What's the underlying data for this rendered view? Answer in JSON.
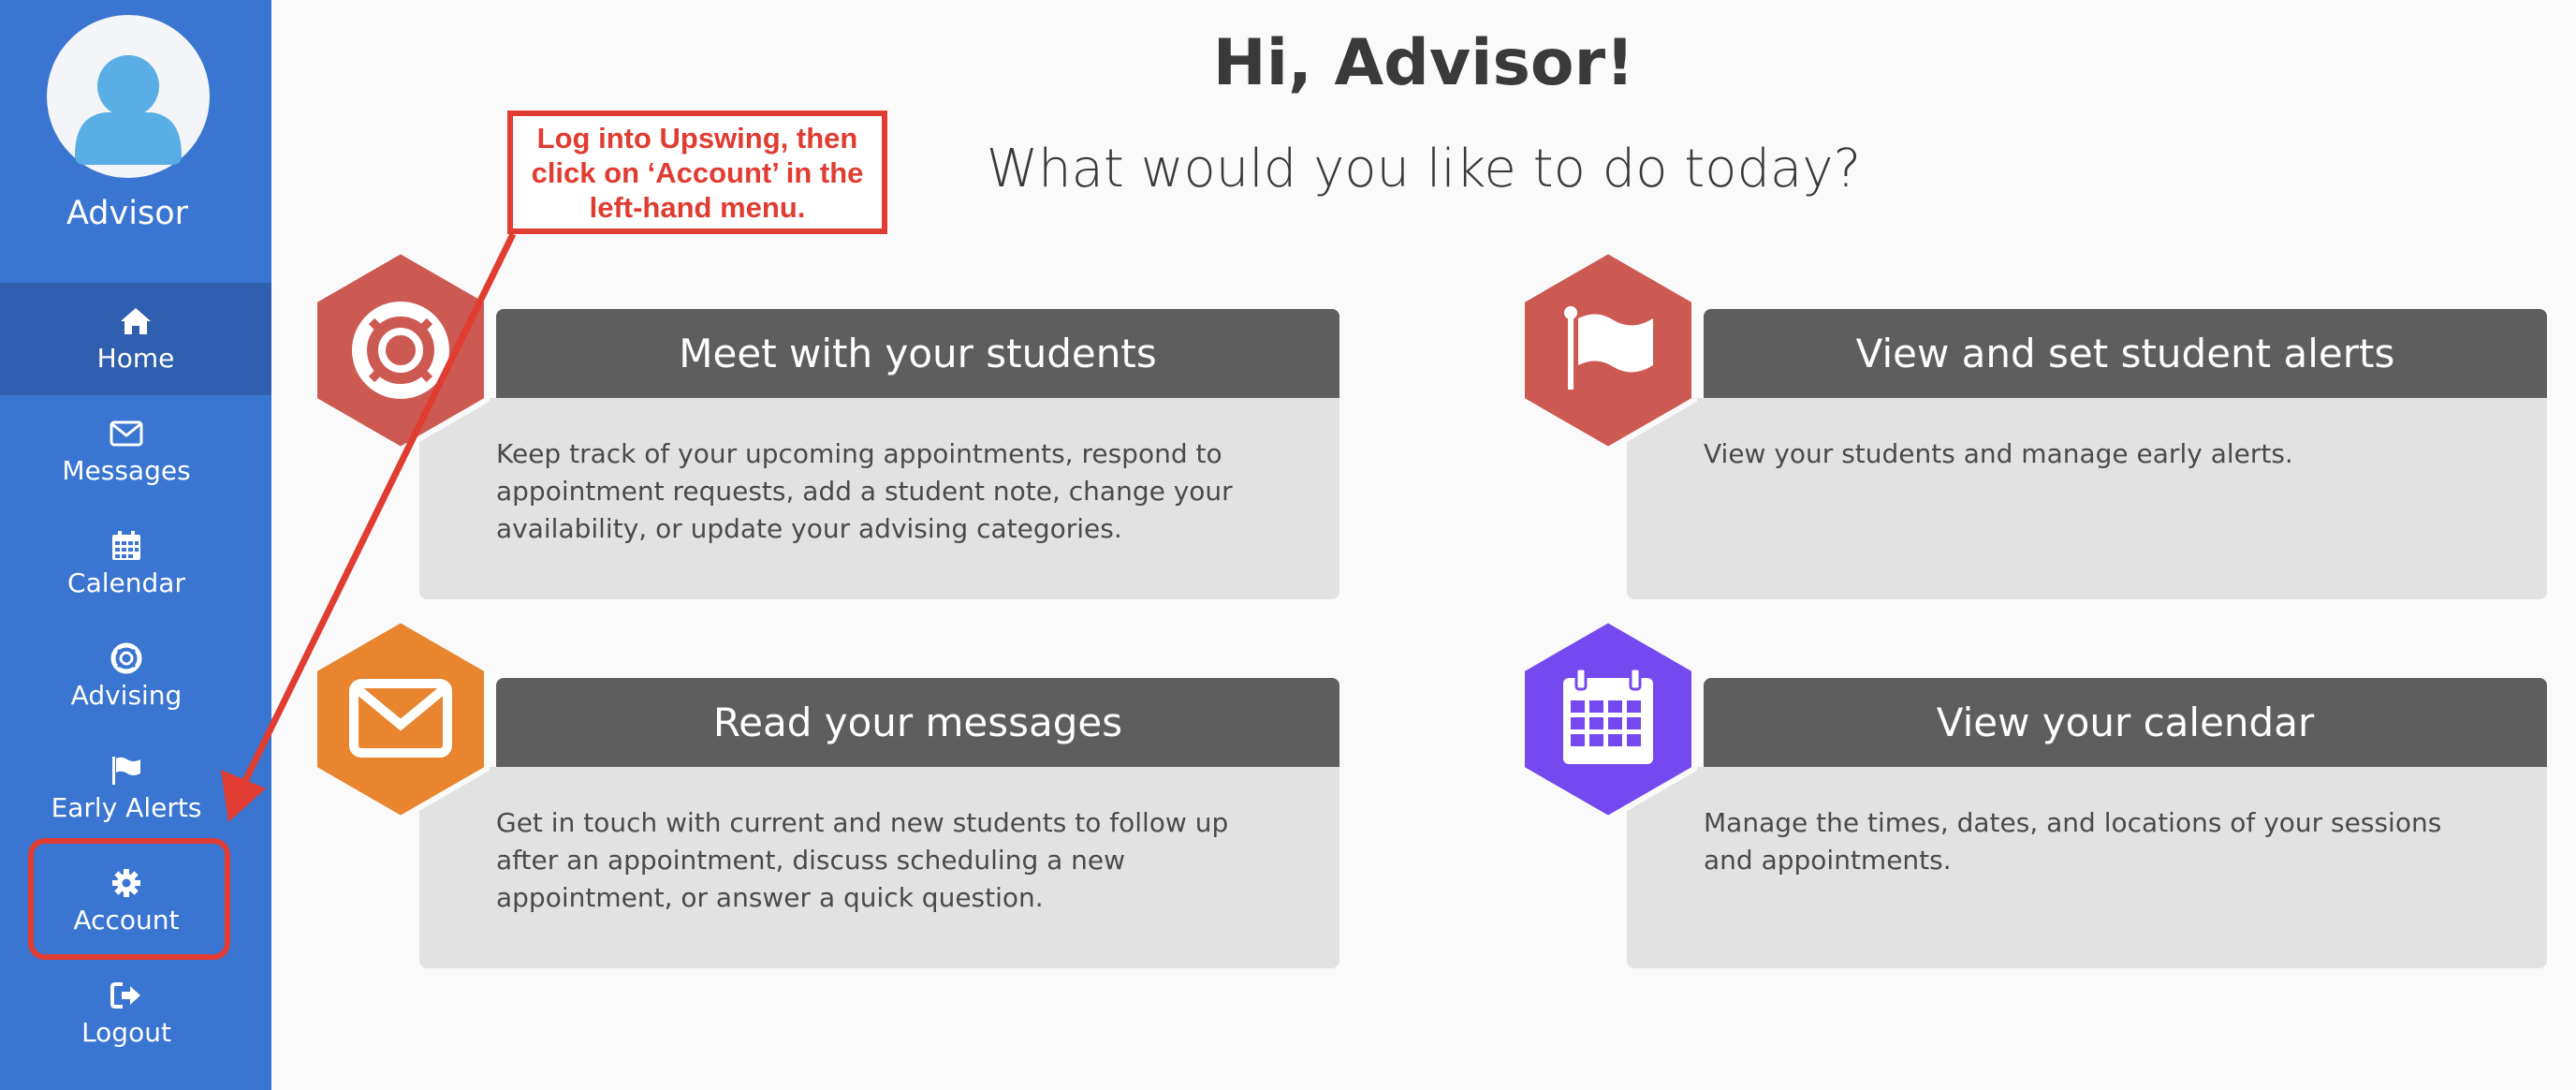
{
  "profile": {
    "name": "Advisor"
  },
  "sidebar": {
    "items": [
      {
        "label": "Home",
        "icon": "home-icon"
      },
      {
        "label": "Messages",
        "icon": "envelope-icon"
      },
      {
        "label": "Calendar",
        "icon": "calendar-icon"
      },
      {
        "label": "Advising",
        "icon": "lifebuoy-icon"
      },
      {
        "label": "Early Alerts",
        "icon": "flag-icon"
      },
      {
        "label": "Account",
        "icon": "gear-icon"
      },
      {
        "label": "Logout",
        "icon": "logout-icon"
      }
    ],
    "active": "Home"
  },
  "header": {
    "greeting": "Hi, Advisor!",
    "subheading": "What would you like to do today?"
  },
  "annotation": {
    "callout_text": "Log into Upswing, then click on ‘Account’ in the left-hand menu.",
    "color": "#e03c31"
  },
  "cards": [
    {
      "title": "Meet with your students",
      "description": "Keep track of your upcoming appointments, respond to appointment requests, add a student note, change your availability, or update your advising categories.",
      "icon": "lifebuoy-icon",
      "hex_color": "#cc5a52"
    },
    {
      "title": "View and set student alerts",
      "description": "View your students and manage early alerts.",
      "icon": "flag-icon",
      "hex_color": "#cc5a52"
    },
    {
      "title": "Read your messages",
      "description": "Get in touch with current and new students to follow up after an appointment, discuss scheduling a new appointment, or answer a quick question.",
      "icon": "envelope-icon",
      "hex_color": "#e8852e"
    },
    {
      "title": "View your calendar",
      "description": "Manage the times, dates, and locations of your sessions and appointments.",
      "icon": "calendar-icon",
      "hex_color": "#7549f0"
    }
  ],
  "colors": {
    "sidebar": "#3975d1",
    "sidebar_active": "#2f5fae",
    "card_header": "#5e5e5e",
    "card_body": "#e2e2e2"
  }
}
